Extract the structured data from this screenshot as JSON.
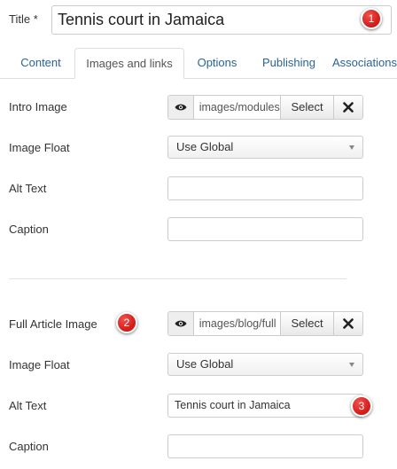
{
  "title": {
    "label": "Title *",
    "value": "Tennis court in Jamaica"
  },
  "tabs": [
    {
      "label": "Content",
      "active": false
    },
    {
      "label": "Images and links",
      "active": true
    },
    {
      "label": "Options",
      "active": false
    },
    {
      "label": "Publishing",
      "active": false
    },
    {
      "label": "Associations",
      "active": false
    }
  ],
  "intro": {
    "image_label": "Intro Image",
    "image_path": "images/modules",
    "select_label": "Select",
    "float_label": "Image Float",
    "float_value": "Use Global",
    "alt_label": "Alt Text",
    "alt_value": "",
    "caption_label": "Caption",
    "caption_value": ""
  },
  "full": {
    "image_label": "Full Article Image",
    "image_path": "images/blog/full",
    "select_label": "Select",
    "float_label": "Image Float",
    "float_value": "Use Global",
    "alt_label": "Alt Text",
    "alt_value": "Tennis court in Jamaica",
    "caption_label": "Caption",
    "caption_value": ""
  },
  "badges": [
    "1",
    "2",
    "3"
  ],
  "icons": {
    "preview": "eye-icon",
    "clear": "close-icon",
    "dropdown": "caret-down-icon"
  },
  "colors": {
    "tab_link": "#2a6496",
    "badge": "#d7201c",
    "border": "#cccccc"
  }
}
